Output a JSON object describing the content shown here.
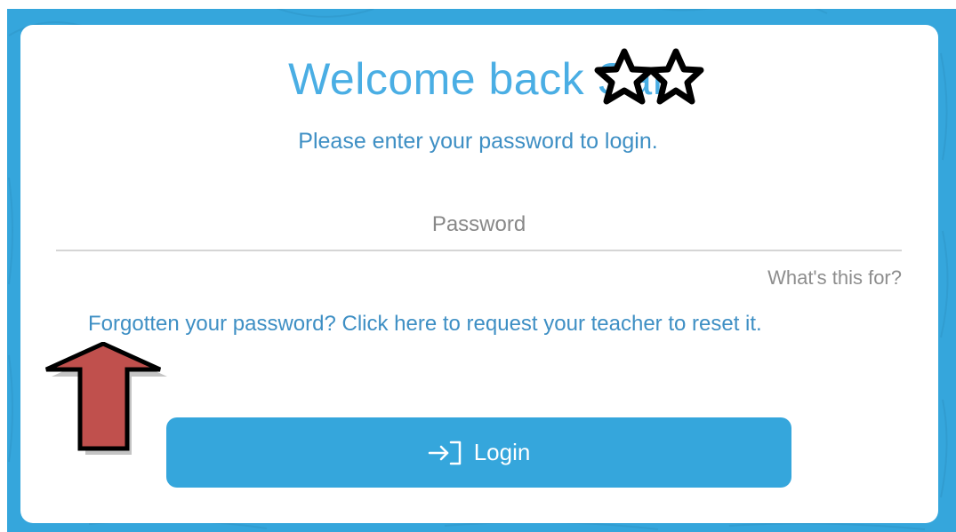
{
  "header": {
    "title": "Welcome back",
    "title_suffix": "Sar",
    "subtitle": "Please enter your password to login."
  },
  "form": {
    "password_placeholder": "Password",
    "whats_this_label": "What's this for?",
    "forgot_label": "Forgotten your password? Click here to request your teacher to reset it.",
    "login_label": "Login"
  },
  "colors": {
    "background_blue": "#35a6dc",
    "title_blue": "#4aaee4",
    "link_blue": "#3e8fc4",
    "arrow_red": "#c0504d"
  },
  "icons": [
    "login-icon",
    "star-icon",
    "arrow-up-icon"
  ]
}
